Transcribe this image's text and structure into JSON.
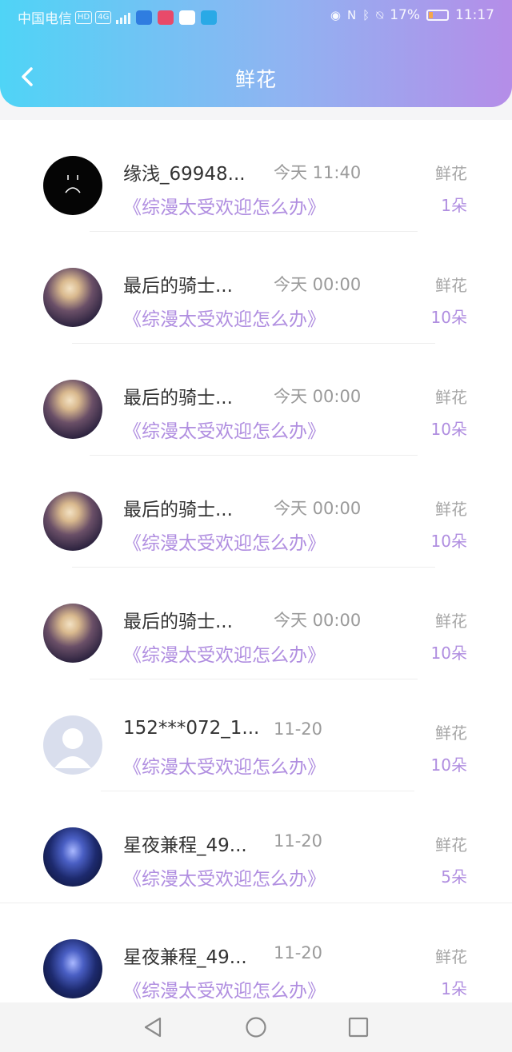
{
  "status_bar": {
    "carrier": "中国电信",
    "hd": "HD",
    "network": "4G",
    "battery": "17%",
    "time": "11:17"
  },
  "header": {
    "title": "鲜花"
  },
  "colors": {
    "accent": "#b08ee0",
    "gradient_start": "#4fd4f6",
    "gradient_end": "#b58de8"
  },
  "rows": [
    {
      "name": "缘浅_69948...",
      "time": "今天 11:40",
      "kind": "鲜花",
      "book": "《综漫太受欢迎怎么办》",
      "count": "1朵",
      "avatar": "sad-face"
    },
    {
      "name": "最后的骑士...",
      "time": "今天 00:00",
      "kind": "鲜花",
      "book": "《综漫太受欢迎怎么办》",
      "count": "10朵",
      "avatar": "anime-girl"
    },
    {
      "name": "最后的骑士...",
      "time": "今天 00:00",
      "kind": "鲜花",
      "book": "《综漫太受欢迎怎么办》",
      "count": "10朵",
      "avatar": "anime-girl"
    },
    {
      "name": "最后的骑士...",
      "time": "今天 00:00",
      "kind": "鲜花",
      "book": "《综漫太受欢迎怎么办》",
      "count": "10朵",
      "avatar": "anime-girl"
    },
    {
      "name": "最后的骑士...",
      "time": "今天 00:00",
      "kind": "鲜花",
      "book": "《综漫太受欢迎怎么办》",
      "count": "10朵",
      "avatar": "anime-girl"
    },
    {
      "name": "152***072_1...",
      "time": "11-20",
      "kind": "鲜花",
      "book": "《综漫太受欢迎怎么办》",
      "count": "10朵",
      "avatar": "default-user"
    },
    {
      "name": "星夜兼程_49...",
      "time": "11-20",
      "kind": "鲜花",
      "book": "《综漫太受欢迎怎么办》",
      "count": "5朵",
      "avatar": "galaxy"
    },
    {
      "name": "星夜兼程_49...",
      "time": "11-20",
      "kind": "鲜花",
      "book": "《综漫太受欢迎怎么办》",
      "count": "1朵",
      "avatar": "galaxy"
    }
  ]
}
